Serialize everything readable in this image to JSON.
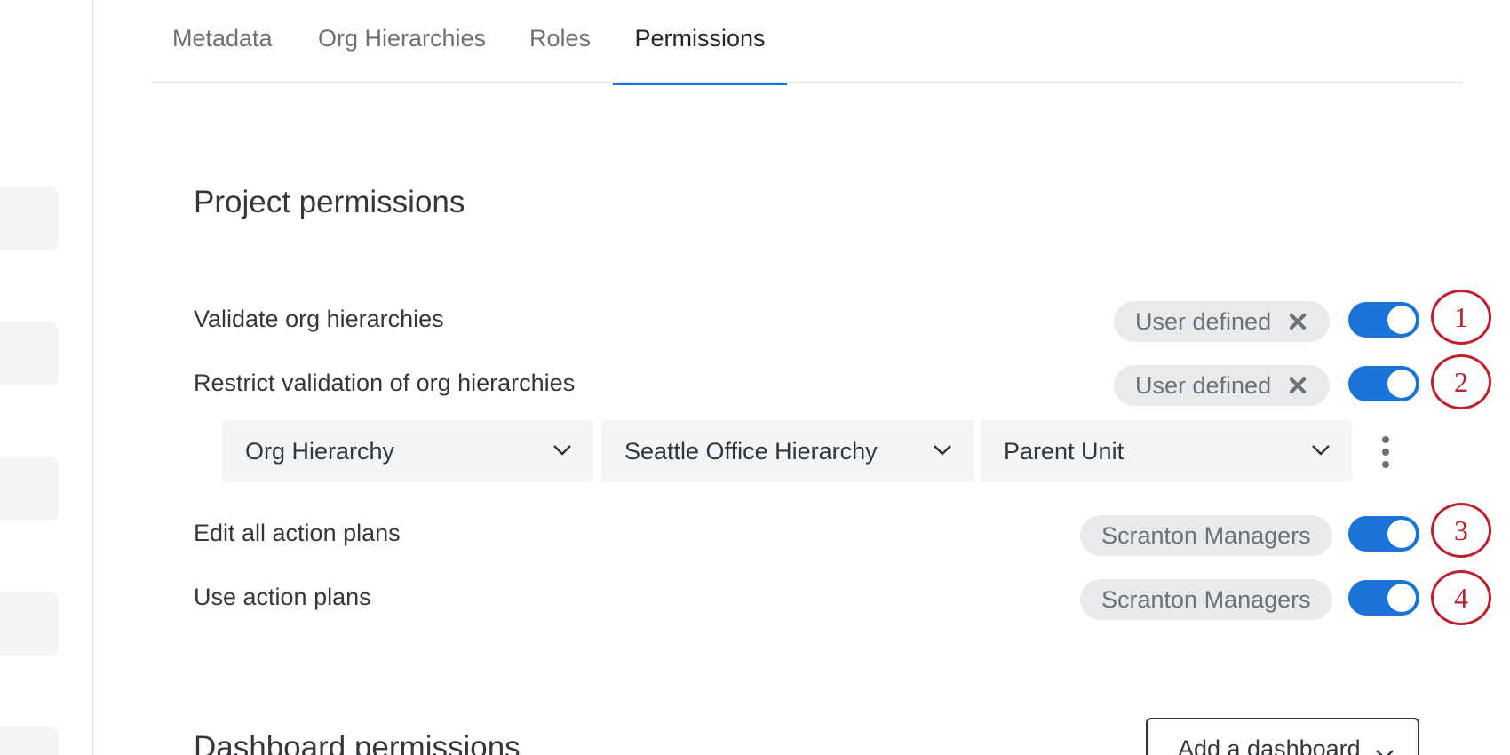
{
  "tabs": [
    {
      "label": "Metadata"
    },
    {
      "label": "Org Hierarchies"
    },
    {
      "label": "Roles"
    },
    {
      "label": "Permissions"
    }
  ],
  "active_tab": "Permissions",
  "project_permissions": {
    "title": "Project permissions",
    "rows": [
      {
        "label": "Validate org hierarchies",
        "chip": "User defined",
        "removable": true,
        "enabled": true,
        "callout": "1"
      },
      {
        "label": "Restrict validation of org hierarchies",
        "chip": "User defined",
        "removable": true,
        "enabled": true,
        "callout": "2"
      },
      {
        "label": "Edit all action plans",
        "chip": "Scranton Managers",
        "removable": false,
        "enabled": true,
        "callout": "3"
      },
      {
        "label": "Use action plans",
        "chip": "Scranton Managers",
        "removable": false,
        "enabled": true,
        "callout": "4"
      }
    ],
    "restriction_selects": [
      {
        "value": "Org Hierarchy"
      },
      {
        "value": "Seattle Office Hierarchy"
      },
      {
        "value": "Parent Unit"
      }
    ]
  },
  "dashboard_permissions": {
    "title": "Dashboard permissions",
    "add_button": "Add a dashboard"
  },
  "colors": {
    "accent": "#1a73d9",
    "callout": "#c0202e",
    "chip_bg": "#e9eaeb"
  }
}
